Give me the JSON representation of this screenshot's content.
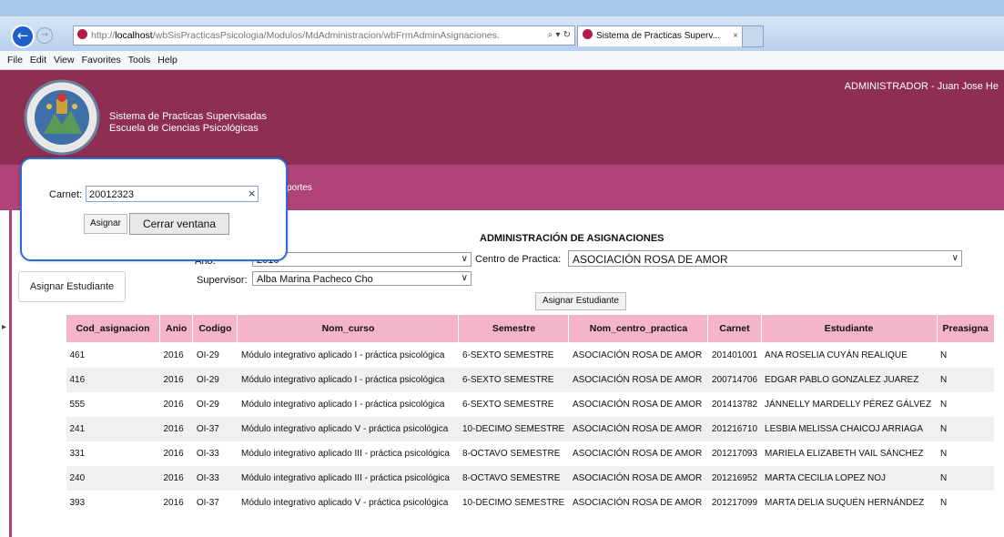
{
  "browser": {
    "url_prefix": "http://",
    "url_host": "localhost",
    "url_path": "/wbSisPracticasPsicologia/Modulos/MdAdministracion/wbFrmAdminAsignaciones.",
    "address_icons": "⌕ ▾ ↻",
    "tab_title": "Sistema de Practicas Superv...",
    "tab_close": "×",
    "menu": [
      "File",
      "Edit",
      "View",
      "Favorites",
      "Tools",
      "Help"
    ]
  },
  "header": {
    "title_line1": "Sistema de Practicas Supervisadas",
    "title_line2": "Escuela de Ciencias Psicológicas",
    "user": "ADMINISTRADOR - Juan Jose He",
    "nav_item": "portes"
  },
  "page": {
    "heading": "ADMINISTRACIÓN DE ASIGNACIONES",
    "left_button": "Asignar Estudiante",
    "center_button": "Asignar Estudiante",
    "anio_label": "Año:",
    "anio_value": "2016",
    "centro_label": "Centro de Practica:",
    "centro_value": "ASOCIACIÓN ROSA DE AMOR",
    "supervisor_label": "Supervisor:",
    "supervisor_value": "Alba Marina Pacheco Cho",
    "caret": "∨"
  },
  "popup": {
    "carnet_label": "Carnet:",
    "carnet_value": "20012323",
    "clear": "×",
    "assign_button": "Asignar",
    "close_button": "Cerrar ventana"
  },
  "table": {
    "headers": [
      "Cod_asignacion",
      "Anio",
      "Codigo",
      "Nom_curso",
      "Semestre",
      "Nom_centro_practica",
      "Carnet",
      "Estudiante",
      "Preasigna"
    ],
    "rows": [
      [
        "461",
        "2016",
        "OI-29",
        "Módulo integrativo aplicado I - práctica psicológica",
        "6-SEXTO SEMESTRE",
        "ASOCIACIÓN ROSA DE AMOR",
        "201401001",
        "ANA ROSELIA CUYÁN REALIQUE",
        "N"
      ],
      [
        "416",
        "2016",
        "OI-29",
        "Módulo integrativo aplicado I - práctica psicológica",
        "6-SEXTO SEMESTRE",
        "ASOCIACIÓN ROSA DE AMOR",
        "200714706",
        "EDGAR PABLO GONZALEZ JUAREZ",
        "N"
      ],
      [
        "555",
        "2016",
        "OI-29",
        "Módulo integrativo aplicado I - práctica psicológica",
        "6-SEXTO SEMESTRE",
        "ASOCIACIÓN ROSA DE AMOR",
        "201413782",
        "JÁNNELLY MARDELLY PÉREZ GÁLVEZ",
        "N"
      ],
      [
        "241",
        "2016",
        "OI-37",
        "Módulo integrativo aplicado V - práctica psicológica",
        "10-DECIMO SEMESTRE",
        "ASOCIACIÓN ROSA DE AMOR",
        "201216710",
        "LESBIA MELISSA CHAICOJ ARRIAGA",
        "N"
      ],
      [
        "331",
        "2016",
        "OI-33",
        "Módulo integrativo aplicado III - práctica psicológica",
        "8-OCTAVO SEMESTRE",
        "ASOCIACIÓN ROSA DE AMOR",
        "201217093",
        "MARIELA ELIZABETH VAIL SÁNCHEZ",
        "N"
      ],
      [
        "240",
        "2016",
        "OI-33",
        "Módulo integrativo aplicado III - práctica psicológica",
        "8-OCTAVO SEMESTRE",
        "ASOCIACIÓN ROSA DE AMOR",
        "201216952",
        "MARTA CECILIA LOPEZ NOJ",
        "N"
      ],
      [
        "393",
        "2016",
        "OI-37",
        "Módulo integrativo aplicado V - práctica psicológica",
        "10-DECIMO SEMESTRE",
        "ASOCIACIÓN ROSA DE AMOR",
        "201217099",
        "MARTA DELIA SUQUÉN HERNÁNDEZ",
        "N"
      ]
    ]
  },
  "colors": {
    "header_bg": "#8e2e52",
    "nav_bg": "#b04478",
    "table_header_bg": "#f4b4cc",
    "popup_border": "#2a6fd6"
  }
}
